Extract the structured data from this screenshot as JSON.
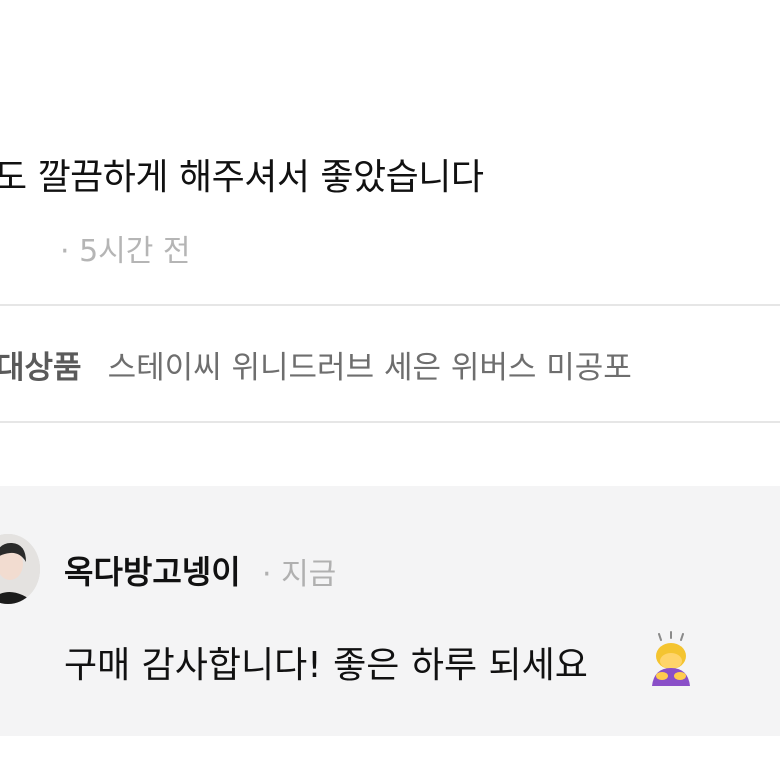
{
  "review": {
    "text": "도 깔끔하게 해주셔서 좋았습니다",
    "meta": "· 5시간 전"
  },
  "product": {
    "label": "대상품",
    "name": "스테이씨 위니드러브 세은 위버스 미공포"
  },
  "reply": {
    "author": "옥다방고넹이",
    "time": "· 지금",
    "text": "구매 감사합니다! 좋은 하루 되세요",
    "avatar_icon": "profile-photo",
    "emoji_icon": "person-bowing-emoji"
  },
  "colors": {
    "reply_background": "#f4f4f5",
    "divider": "#e6e6e6",
    "muted_text": "#b0b0b0"
  }
}
